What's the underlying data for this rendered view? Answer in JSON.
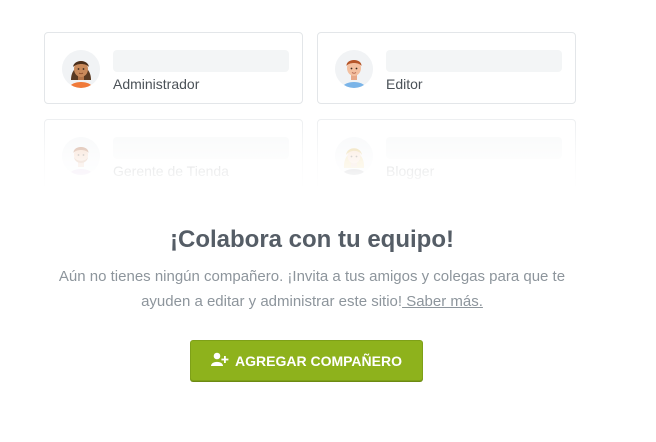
{
  "team_cards": [
    {
      "role": "Administrador",
      "avatar": "woman-avatar-icon"
    },
    {
      "role": "Editor",
      "avatar": "man-avatar-icon"
    },
    {
      "role": "Gerente de Tienda",
      "avatar": "bearded-man-avatar-icon"
    },
    {
      "role": "Blogger",
      "avatar": "blonde-woman-avatar-icon"
    }
  ],
  "heading": "¡Colabora con tu equipo!",
  "description": {
    "line1": "Aún no tienes ningún compañero. ¡Invita a tus amigos y colegas para que te",
    "line2": "ayuden a editar y administrar este sitio!",
    "learn_more": " Saber más."
  },
  "add_button": {
    "label": "AGREGAR COMPAÑERO",
    "icon": "add-user-icon",
    "color": "#8eb21c"
  }
}
